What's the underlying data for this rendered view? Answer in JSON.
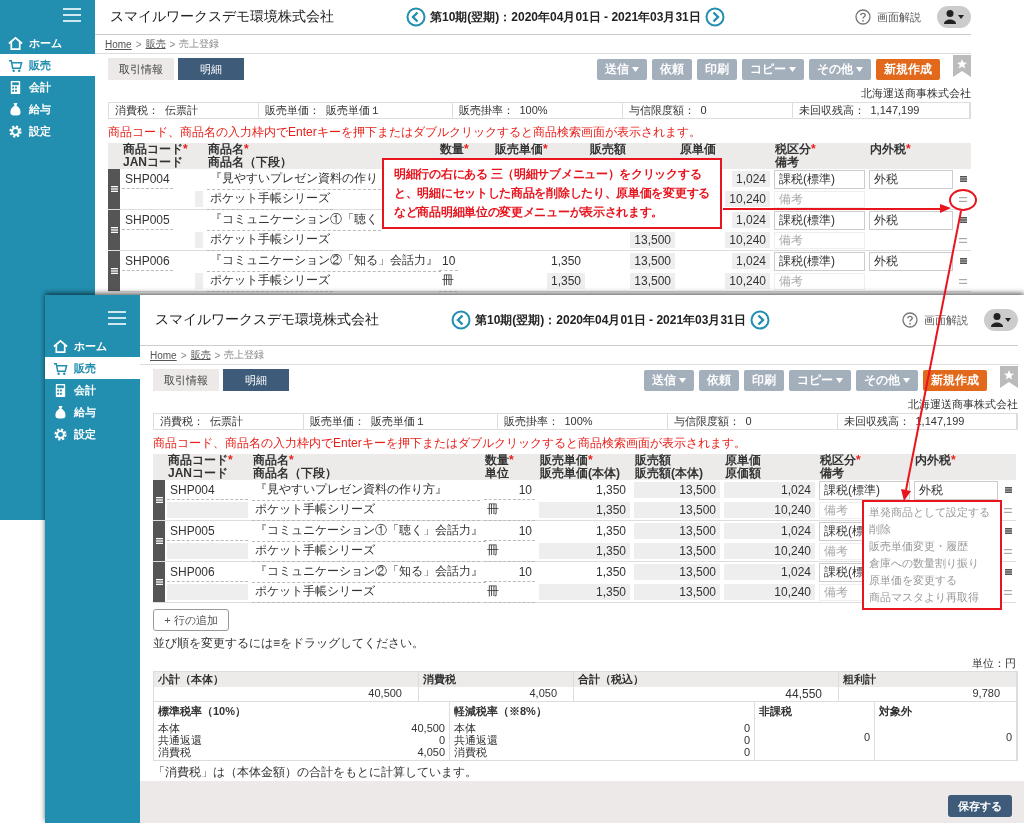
{
  "windows": [
    {
      "sidebar": {
        "items": [
          {
            "label": "ホーム",
            "selected": false
          },
          {
            "label": "販売",
            "selected": true
          },
          {
            "label": "会計",
            "selected": false
          },
          {
            "label": "給与",
            "selected": false
          },
          {
            "label": "設定",
            "selected": false
          }
        ]
      },
      "header": {
        "company": "スマイルワークスデモ環境株式会社",
        "period": "第10期(翌期)：2020年04月01日 - 2021年03月31日",
        "help": "画面解説"
      },
      "breadcrumb": [
        {
          "label": "Home",
          "kind": "link"
        },
        {
          "label": ">",
          "kind": "separator"
        },
        {
          "label": "販売",
          "kind": "link"
        },
        {
          "label": ">",
          "kind": "separator"
        },
        {
          "label": "売上登録",
          "kind": "current"
        }
      ],
      "tabs": [
        {
          "label": "取引情報",
          "selected": false
        },
        {
          "label": "明細",
          "selected": true
        }
      ],
      "actions": [
        {
          "label": "送信",
          "dropdown": true,
          "disabled": true
        },
        {
          "label": "依頼",
          "dropdown": false,
          "disabled": true
        },
        {
          "label": "印刷",
          "dropdown": false,
          "disabled": true
        },
        {
          "label": "コピー",
          "dropdown": true,
          "disabled": true
        },
        {
          "label": "その他",
          "dropdown": true,
          "disabled": true
        },
        {
          "label": "新規作成",
          "dropdown": false,
          "disabled": false
        }
      ],
      "customer": "北海運送商事株式会社",
      "info": [
        {
          "label": "消費税：",
          "value": "伝票計"
        },
        {
          "label": "販売単価：",
          "value": "販売単価１"
        },
        {
          "label": "販売掛率：",
          "value": "100%"
        },
        {
          "label": "与信限度額：",
          "value": "0"
        },
        {
          "label": "未回収残高：",
          "value": "1,147,199"
        }
      ],
      "notice": "商品コード、商品名の入力枠内でEnterキーを押下またはダブルクリックすると商品検索画面が表示されます。",
      "table": {
        "columns": [
          {
            "label": "商品コード",
            "mark": "*",
            "sub": "JANコード"
          },
          {
            "label": "商品名",
            "mark": "*",
            "sub": "商品名（下段）"
          },
          {
            "label": "数量",
            "mark": "*"
          },
          {
            "label": "販売単価",
            "mark": "*"
          },
          {
            "label": "販売額"
          },
          {
            "label": "原単価"
          },
          {
            "label": "税区分",
            "mark": "*",
            "sub": "備考"
          },
          {
            "label": "内外税",
            "mark": "*"
          }
        ],
        "rows": [
          {
            "code": "SHP004",
            "name": "『見やすいプレゼン資料の作り",
            "cost": "1,024",
            "tax": "課税(標準)",
            "inout": "外税",
            "sub_name": "ポケット手帳シリーズ",
            "cost_amount": "10,240",
            "remark_placeholder": "備考"
          },
          {
            "code": "SHP005",
            "name": "『コミュニケーション①「聴く",
            "cost": "1,024",
            "tax": "課税(標準)",
            "inout": "外税",
            "sub_name": "ポケット手帳シリーズ",
            "sub_amount": "13,500",
            "cost_amount": "10,240",
            "remark_placeholder": "備考"
          },
          {
            "code": "SHP006",
            "name": "『コミュニケーション②「知る」会話力』",
            "qty": "10",
            "price": "1,350",
            "amount": "13,500",
            "cost": "1,024",
            "tax": "課税(標準)",
            "inout": "外税",
            "sub_name": "ポケット手帳シリーズ",
            "unit": "冊",
            "sub_price": "1,350",
            "sub_amount": "13,500",
            "cost_amount": "10,240",
            "remark_placeholder": "備考"
          }
        ]
      }
    },
    {
      "sidebar": {
        "items": [
          {
            "label": "ホーム",
            "selected": false
          },
          {
            "label": "販売",
            "selected": true
          },
          {
            "label": "会計",
            "selected": false
          },
          {
            "label": "給与",
            "selected": false
          },
          {
            "label": "設定",
            "selected": false
          }
        ]
      },
      "header": {
        "company": "スマイルワークスデモ環境株式会社",
        "period": "第10期(翌期)：2020年04月01日 - 2021年03月31日",
        "help": "画面解説"
      },
      "breadcrumb": [
        {
          "label": "Home",
          "kind": "link"
        },
        {
          "label": ">",
          "kind": "separator"
        },
        {
          "label": "販売",
          "kind": "link"
        },
        {
          "label": ">",
          "kind": "separator"
        },
        {
          "label": "売上登録",
          "kind": "current"
        }
      ],
      "tabs": [
        {
          "label": "取引情報",
          "selected": false
        },
        {
          "label": "明細",
          "selected": true
        }
      ],
      "actions": [
        {
          "label": "送信",
          "dropdown": true,
          "disabled": true
        },
        {
          "label": "依頼",
          "dropdown": false,
          "disabled": true
        },
        {
          "label": "印刷",
          "dropdown": false,
          "disabled": true
        },
        {
          "label": "コピー",
          "dropdown": true,
          "disabled": true
        },
        {
          "label": "その他",
          "dropdown": true,
          "disabled": true
        },
        {
          "label": "新規作成",
          "dropdown": false,
          "disabled": false
        }
      ],
      "customer": "北海運送商事株式会社",
      "info": [
        {
          "label": "消費税：",
          "value": "伝票計"
        },
        {
          "label": "販売単価：",
          "value": "販売単価１"
        },
        {
          "label": "販売掛率：",
          "value": "100%"
        },
        {
          "label": "与信限度額：",
          "value": "0"
        },
        {
          "label": "未回収残高：",
          "value": "1,147,199"
        }
      ],
      "notice": "商品コード、商品名の入力枠内でEnterキーを押下またはダブルクリックすると商品検索画面が表示されます。",
      "table": {
        "columns": [
          {
            "label": "商品コード",
            "mark": "*",
            "sub": "JANコード"
          },
          {
            "label": "商品名",
            "mark": "*",
            "sub": "商品名（下段）"
          },
          {
            "label": "数量",
            "mark": "*",
            "sub": "単位"
          },
          {
            "label": "販売単価",
            "mark": "*",
            "sub": "販売単価(本体)"
          },
          {
            "label": "販売額",
            "sub": "販売額(本体)"
          },
          {
            "label": "原単価",
            "sub": "原価額"
          },
          {
            "label": "税区分",
            "mark": "*",
            "sub": "備考"
          },
          {
            "label": "内外税",
            "mark": "*"
          }
        ],
        "rows": [
          {
            "code": "SHP004",
            "name": "『見やすいプレゼン資料の作り方』",
            "qty": "10",
            "price": "1,350",
            "amount": "13,500",
            "cost": "1,024",
            "tax": "課税(標準)",
            "inout": "外税",
            "sub_name": "ポケット手帳シリーズ",
            "unit": "冊",
            "sub_price": "1,350",
            "sub_amount": "13,500",
            "cost_amount": "10,240",
            "remark_placeholder": "備考"
          },
          {
            "code": "SHP005",
            "name": "『コミュニケーション①「聴く」会話力』",
            "qty": "10",
            "price": "1,350",
            "amount": "13,500",
            "cost": "1,024",
            "tax": "課税(標",
            "sub_name": "ポケット手帳シリーズ",
            "unit": "冊",
            "sub_price": "1,350",
            "sub_amount": "13,500",
            "cost_amount": "10,240",
            "remark_placeholder": "備考"
          },
          {
            "code": "SHP006",
            "name": "『コミュニケーション②「知る」会話力』",
            "qty": "10",
            "price": "1,350",
            "amount": "13,500",
            "cost": "1,024",
            "tax": "課税(標",
            "sub_name": "ポケット手帳シリーズ",
            "unit": "冊",
            "sub_price": "1,350",
            "sub_amount": "13,500",
            "cost_amount": "10,240",
            "remark_placeholder": "備考"
          }
        ]
      },
      "submenu": [
        "単発商品として設定する",
        "削除",
        "販売単価変更・履歴",
        "倉庫への数量割り振り",
        "原単価を変更する",
        "商品マスタより再取得"
      ],
      "add_row": "+ 行の追加",
      "drag_hint": "並び順を変更するには≡をドラッグしてください。",
      "unit": "単位：円",
      "totals": [
        {
          "label": "小計（本体）",
          "value": "40,500"
        },
        {
          "label": "消費税",
          "value": "4,050"
        },
        {
          "label": "合計（税込）",
          "value": "44,550"
        },
        {
          "label": "粗利計",
          "value": "9,780"
        }
      ],
      "breakdown": [
        {
          "title": "標準税率（10%）",
          "lines": [
            {
              "label": "本体",
              "value": "40,500"
            },
            {
              "label": "共通返還",
              "value": "0"
            },
            {
              "label": "消費税",
              "value": "4,050"
            }
          ]
        },
        {
          "title": "軽減税率（※8%）",
          "lines": [
            {
              "label": "本体",
              "value": "0"
            },
            {
              "label": "共通返還",
              "value": "0"
            },
            {
              "label": "消費税",
              "value": "0"
            }
          ]
        },
        {
          "title": "非課税",
          "lines": [
            {
              "value": "0"
            }
          ]
        },
        {
          "title": "対象外",
          "lines": [
            {
              "value": "0"
            }
          ]
        }
      ],
      "footnote": "「消費税」は（本体金額）の合計をもとに計算しています。",
      "save": "保存する"
    }
  ],
  "callout": "明細行の右にある 三（明細サブメニュー）をクリックすると、明細にセットした商品を削除したり、原単価を変更するなど商品明細単位の変更メニューが表示されます。"
}
